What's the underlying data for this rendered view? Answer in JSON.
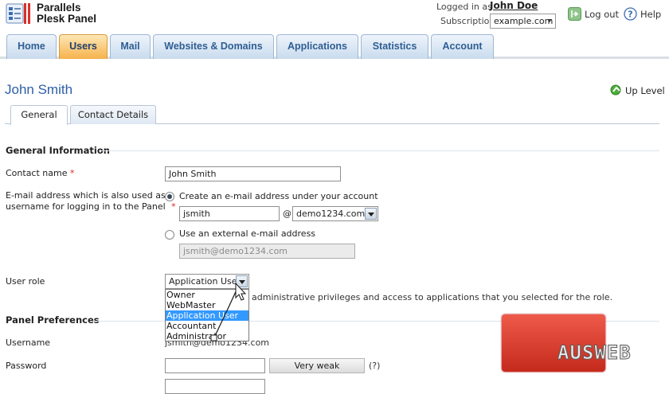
{
  "header": {
    "logo_line1": "Parallels",
    "logo_line2": "Plesk Panel",
    "logged_in_label": "Logged in as",
    "logged_in_user": "John Doe",
    "subscription_label": "Subscription",
    "subscription_value": "example.com",
    "logout_label": "Log out",
    "help_label": "Help"
  },
  "nav": {
    "tabs": [
      {
        "label": "Home"
      },
      {
        "label": "Users"
      },
      {
        "label": "Mail"
      },
      {
        "label": "Websites & Domains"
      },
      {
        "label": "Applications"
      },
      {
        "label": "Statistics"
      },
      {
        "label": "Account"
      }
    ],
    "active": "Users"
  },
  "page": {
    "title": "John Smith",
    "up_level": "Up Level",
    "subtabs": [
      {
        "label": "General"
      },
      {
        "label": "Contact Details"
      }
    ]
  },
  "general": {
    "section_title": "General Information",
    "contact_name_label": "Contact name",
    "contact_name_value": "John Smith",
    "email_label_line1": "E-mail address which is also used as a",
    "email_label_line2": "username for logging in to the Panel",
    "required_mark": "*",
    "radio_create_label": "Create an e-mail address under your account",
    "email_local_value": "jsmith",
    "at_sign": "@",
    "email_domain_value": "demo1234.com",
    "radio_external_label": "Use an external e-mail address",
    "external_email_value": "jsmith@demo1234.com",
    "user_role_label": "User role",
    "user_role_value": "Application User",
    "user_role_options": [
      "Owner",
      "WebMaster",
      "Application User",
      "Accountant",
      "Administrator"
    ],
    "role_description": "administrative privileges and access to applications that you selected for the role."
  },
  "preferences": {
    "section_title": "Panel Preferences",
    "username_label": "Username",
    "username_value": "jsmith@demo1234.com",
    "password_label": "Password",
    "password_value": "",
    "strength_label": "Very weak",
    "help_mark": "(?)"
  },
  "watermark": {
    "text": "AUSWEB"
  },
  "colors": {
    "accent_blue": "#2b5ea8",
    "active_tab": "#f6b24c",
    "selection": "#3399ff",
    "required": "#dd2222"
  }
}
